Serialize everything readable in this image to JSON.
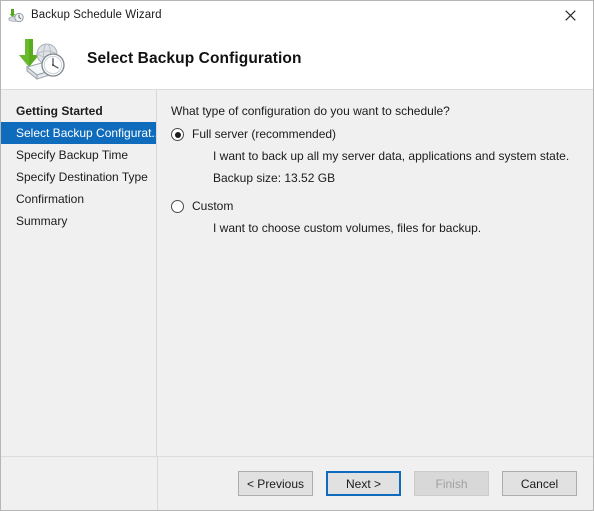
{
  "window": {
    "title": "Backup Schedule Wizard",
    "title_icon": "backup-clock-icon",
    "close_label": "close-icon"
  },
  "header": {
    "title": "Select Backup Configuration",
    "icon": "backup-drive-clock-icon"
  },
  "sidebar": {
    "items": [
      {
        "label": "Getting Started",
        "state": "completed"
      },
      {
        "label": "Select Backup Configurat...",
        "state": "active"
      },
      {
        "label": "Specify Backup Time",
        "state": "pending"
      },
      {
        "label": "Specify Destination Type",
        "state": "pending"
      },
      {
        "label": "Confirmation",
        "state": "pending"
      },
      {
        "label": "Summary",
        "state": "pending"
      }
    ]
  },
  "main": {
    "question": "What type of configuration do you want to schedule?",
    "options": [
      {
        "label": "Full server (recommended)",
        "selected": true,
        "description": "I want to back up all my server data, applications and system state.",
        "detail": "Backup size: 13.52 GB"
      },
      {
        "label": "Custom",
        "selected": false,
        "description": "I want to choose custom volumes, files for backup.",
        "detail": ""
      }
    ]
  },
  "footer": {
    "buttons": [
      {
        "label": "< Previous",
        "style": "normal"
      },
      {
        "label": "Next >",
        "style": "default"
      },
      {
        "label": "Finish",
        "style": "disabled"
      },
      {
        "label": "Cancel",
        "style": "normal"
      }
    ]
  },
  "colors": {
    "accent": "#0f6cbd",
    "panel": "#f0f0f0",
    "text": "#1b1b1b",
    "disabled_text": "#a0a0a0",
    "arrow_green": "#57a81e"
  }
}
